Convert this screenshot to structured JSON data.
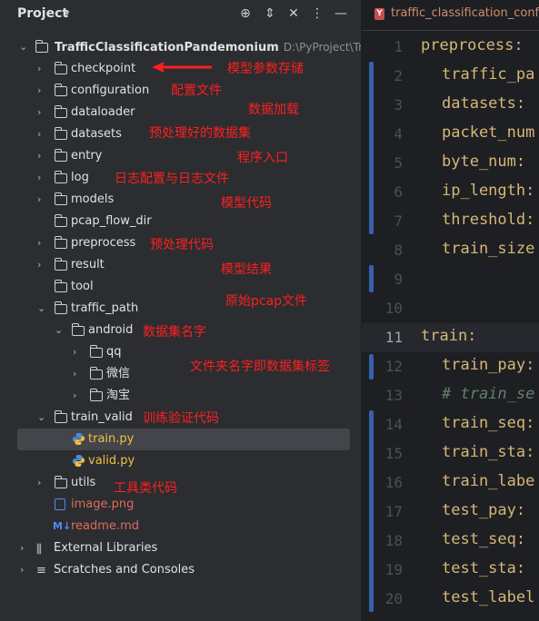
{
  "panel": {
    "title": "Project",
    "icons": [
      "crosshair-icon",
      "expand-collapse-icon",
      "close-all-icon",
      "more-icon",
      "minimize-icon"
    ]
  },
  "tree": {
    "root": {
      "name": "TrafficClassificationPandemonium",
      "path": "D:\\PyProject\\Traffic"
    },
    "items": [
      {
        "label": "checkpoint"
      },
      {
        "label": "configuration"
      },
      {
        "label": "dataloader"
      },
      {
        "label": "datasets"
      },
      {
        "label": "entry"
      },
      {
        "label": "log"
      },
      {
        "label": "models"
      },
      {
        "label": "pcap_flow_dir"
      },
      {
        "label": "preprocess"
      },
      {
        "label": "result"
      },
      {
        "label": "tool"
      },
      {
        "label": "traffic_path"
      },
      {
        "label": "android"
      },
      {
        "label": "qq"
      },
      {
        "label": "微信"
      },
      {
        "label": "淘宝"
      },
      {
        "label": "train_valid"
      },
      {
        "label": "train.py"
      },
      {
        "label": "valid.py"
      },
      {
        "label": "utils"
      },
      {
        "label": "image.png"
      },
      {
        "label": "readme.md"
      },
      {
        "label": "External Libraries"
      },
      {
        "label": "Scratches and Consoles"
      }
    ]
  },
  "annotations": {
    "checkpoint": "模型参数存储",
    "configuration": "配置文件",
    "dataloader": "数据加载",
    "datasets": "预处理好的数据集",
    "entry": "程序入口",
    "log": "日志配置与日志文件",
    "models": "模型代码",
    "preprocess": "预处理代码",
    "result": "模型结果",
    "traffic_path": "原始pcap文件",
    "android": "数据集名字",
    "apps": "文件夹名字即数据集标签",
    "train_valid": "训练验证代码",
    "utils": "工具类代码"
  },
  "editor": {
    "tab_label": "traffic_classification_config",
    "lines": [
      {
        "num": "1",
        "text": "preprocess:"
      },
      {
        "num": "2",
        "text": "traffic_pa"
      },
      {
        "num": "3",
        "text": "datasets:"
      },
      {
        "num": "4",
        "text": "packet_num"
      },
      {
        "num": "5",
        "text": "byte_num:"
      },
      {
        "num": "6",
        "text": "ip_length:"
      },
      {
        "num": "7",
        "text": "threshold:"
      },
      {
        "num": "8",
        "text": "train_size"
      },
      {
        "num": "9",
        "text": ""
      },
      {
        "num": "10",
        "text": ""
      },
      {
        "num": "11",
        "text": "train:"
      },
      {
        "num": "12",
        "text": "train_pay:"
      },
      {
        "num": "13",
        "text": "# train_se"
      },
      {
        "num": "14",
        "text": "train_seq:"
      },
      {
        "num": "15",
        "text": "train_sta:"
      },
      {
        "num": "16",
        "text": "train_labe"
      },
      {
        "num": "17",
        "text": "test_pay:"
      },
      {
        "num": "18",
        "text": "test_seq:"
      },
      {
        "num": "19",
        "text": "test_sta:"
      },
      {
        "num": "20",
        "text": "test_label"
      }
    ]
  },
  "colors": {
    "annotation": "#ff1f1f",
    "key": "#d5b778",
    "comment": "#5f826b",
    "python": "#f0c040"
  }
}
